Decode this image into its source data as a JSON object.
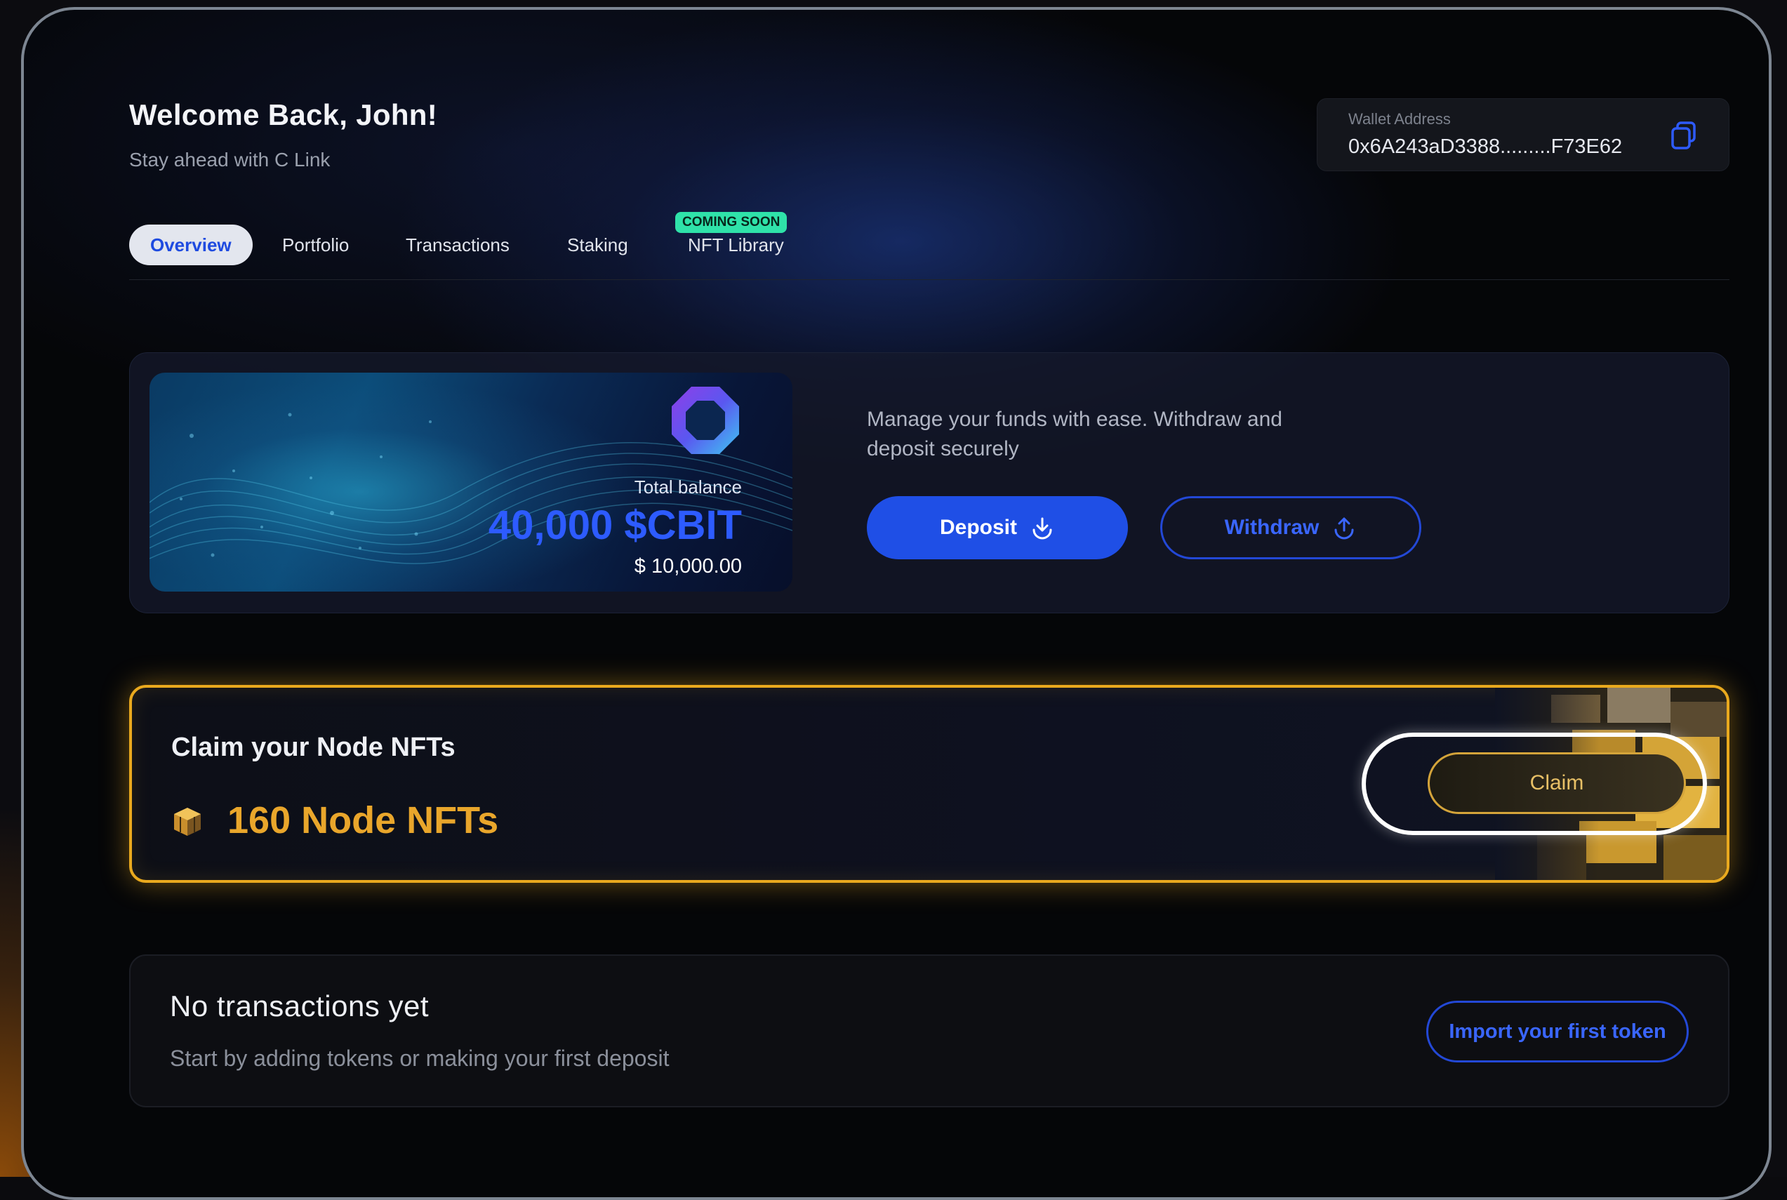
{
  "header": {
    "title": "Welcome Back, John!",
    "subtitle": "Stay ahead with C Link"
  },
  "wallet": {
    "label": "Wallet Address",
    "address": "0x6A243aD3388.........F73E62",
    "copy_icon": "copy-icon"
  },
  "tabs": [
    {
      "label": "Overview",
      "active": true
    },
    {
      "label": "Portfolio"
    },
    {
      "label": "Transactions"
    },
    {
      "label": "Staking"
    },
    {
      "label": "NFT Library",
      "badge": "COMING SOON"
    }
  ],
  "balance": {
    "label": "Total balance",
    "amount": "40,000 $CBIT",
    "usd": "$ 10,000.00",
    "logo_icon": "octagon-logo-icon"
  },
  "funds": {
    "description": "Manage your funds with ease. Withdraw and deposit securely",
    "deposit_label": "Deposit",
    "deposit_icon": "download-icon",
    "withdraw_label": "Withdraw",
    "withdraw_icon": "upload-icon"
  },
  "claim": {
    "title": "Claim your Node NFTs",
    "count": "160 Node NFTs",
    "button_label": "Claim",
    "icon": "nft-box-icon"
  },
  "transactions": {
    "title": "No transactions yet",
    "subtitle": "Start by adding tokens or making your first deposit",
    "import_label": "Import your first token"
  },
  "colors": {
    "accent_blue": "#1f4fe6",
    "gold": "#e9a91e",
    "badge_green": "#2fe2a9"
  }
}
